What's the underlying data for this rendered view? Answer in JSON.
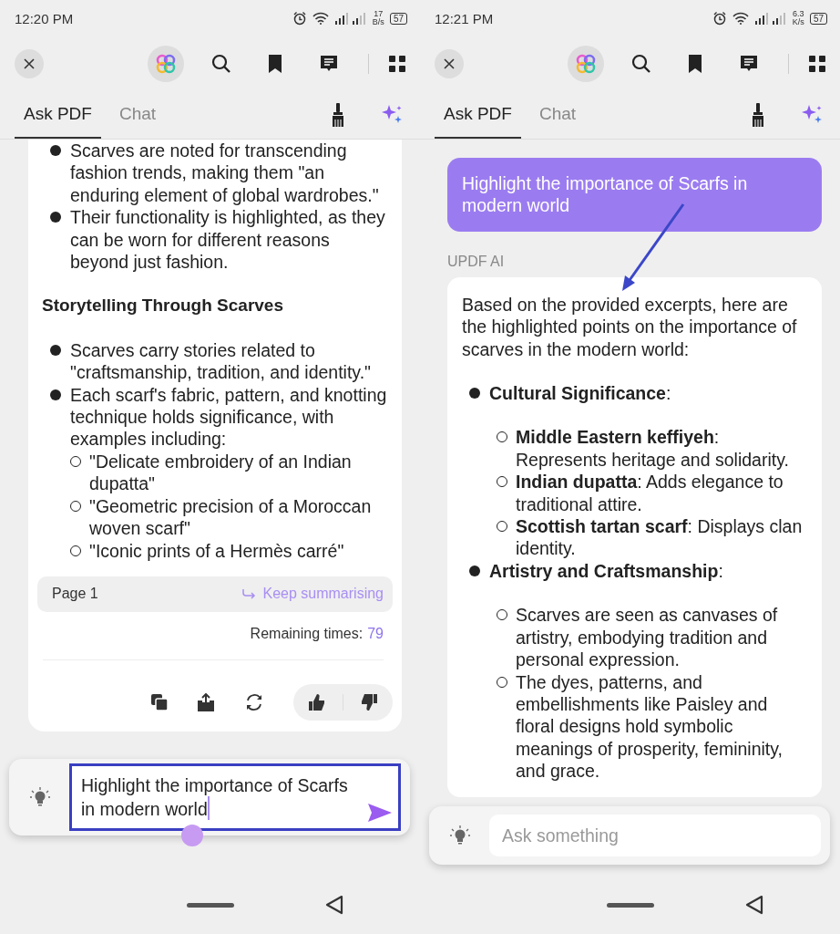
{
  "screens": [
    {
      "status": {
        "time": "12:20 PM",
        "speed_value": "17",
        "speed_unit": "B/s",
        "battery": "57"
      },
      "tabs": [
        {
          "label": "Ask PDF",
          "selected": true
        },
        {
          "label": "Chat",
          "selected": false
        }
      ],
      "answer": {
        "blocks": [
          {
            "kind": "bullet",
            "text": "Scarves are noted for transcending fashion trends, making them \"an enduring element of global wardrobes.\""
          },
          {
            "kind": "bullet",
            "text": "Their functionality is highlighted, as they can be worn for different reasons beyond just fashion."
          },
          {
            "kind": "heading",
            "text": "Storytelling Through Scarves"
          },
          {
            "kind": "bullet",
            "text": "Scarves carry stories related to \"craftsmanship, tradition, and identity.\""
          },
          {
            "kind": "bullet",
            "text": "Each scarf's fabric, pattern, and knotting technique holds significance, with examples including:",
            "children": [
              {
                "text": "\"Delicate embroidery of an Indian dupatta\""
              },
              {
                "text": "\"Geometric precision of a Moroccan woven scarf\""
              },
              {
                "text": "\"Iconic prints of a Hermès carré\""
              }
            ]
          }
        ],
        "page_label": "Page 1",
        "keep_link": "Keep summarising",
        "remaining_label": "Remaining times:",
        "remaining_count": "79"
      },
      "input": {
        "value": "Highlight the importance of Scarfs in modern world",
        "cursor": true
      },
      "annotation": {
        "kind": "box"
      }
    },
    {
      "status": {
        "time": "12:21 PM",
        "speed_value": "6.3",
        "speed_unit": "K/s",
        "battery": "57"
      },
      "tabs": [
        {
          "label": "Ask PDF",
          "selected": true
        },
        {
          "label": "Chat",
          "selected": false
        }
      ],
      "question": "Highlight the importance of Scarfs in modern world",
      "sender": "UPDF AI",
      "answer": {
        "blocks": [
          {
            "kind": "paragraph",
            "text": "Based on the provided excerpts, here are the highlighted points on the importance of scarves in the modern world:"
          },
          {
            "kind": "bullet",
            "text": "**Cultural Significance**:",
            "children": [
              {
                "text": "**Middle Eastern keffiyeh**: Represents heritage and solidarity."
              },
              {
                "text": "**Indian dupatta**: Adds elegance to traditional attire."
              },
              {
                "text": "**Scottish tartan scarf**: Displays clan identity."
              }
            ]
          },
          {
            "kind": "bullet",
            "text": "**Artistry and Craftsmanship**:",
            "children": [
              {
                "text": "Scarves are seen as canvases of artistry, embodying tradition and personal expression."
              },
              {
                "text": "The dyes, patterns, and embellishments like Paisley and floral designs hold symbolic meanings of prosperity, femininity, and grace."
              }
            ]
          }
        ]
      },
      "input": {
        "placeholder": "Ask something"
      },
      "annotation": {
        "kind": "arrow"
      }
    }
  ]
}
